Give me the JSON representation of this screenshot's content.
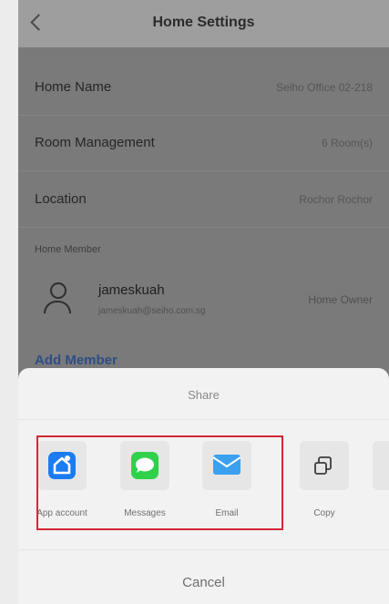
{
  "header": {
    "title": "Home Settings"
  },
  "settings": [
    {
      "label": "Home Name",
      "value": "Seiho Office 02-218"
    },
    {
      "label": "Room Management",
      "value": "6 Room(s)"
    },
    {
      "label": "Location",
      "value": "Rochor Rochor"
    }
  ],
  "members": {
    "section_label": "Home Member",
    "items": [
      {
        "name": "jameskuah",
        "email": "jameskuah@seiho.com.sg",
        "role": "Home Owner"
      }
    ],
    "add_label": "Add Member"
  },
  "share_sheet": {
    "title": "Share",
    "items": [
      {
        "label": "App account",
        "icon": "app-account-icon"
      },
      {
        "label": "Messages",
        "icon": "messages-icon"
      },
      {
        "label": "Email",
        "icon": "email-icon"
      },
      {
        "label": "Copy",
        "icon": "copy-icon"
      }
    ],
    "cancel_label": "Cancel"
  },
  "colors": {
    "app_account": "#1a7cf0",
    "messages": "#2fd14a",
    "email": "#3aa0ef",
    "highlight": "#d42638"
  }
}
